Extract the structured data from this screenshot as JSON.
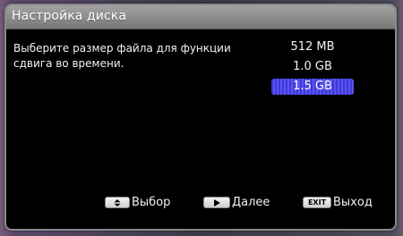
{
  "dialog": {
    "title": "Настройка диска",
    "prompt": "Выберите размер файла для функции сдвига во времени."
  },
  "options": [
    {
      "label": "512 MB",
      "selected": false
    },
    {
      "label": "1.0 GB",
      "selected": false
    },
    {
      "label": "1.5 GB",
      "selected": true
    }
  ],
  "footer": {
    "select_label": "Выбор",
    "next_label": "Далее",
    "exit_key": "EXIT",
    "exit_label": "Выход"
  },
  "colors": {
    "selection": "#4a44e6",
    "titlebar": "#8f8f8f",
    "background": "#000000"
  },
  "icons": {
    "select_key": "up-down-arrows-icon",
    "next_key": "play-right-icon"
  }
}
